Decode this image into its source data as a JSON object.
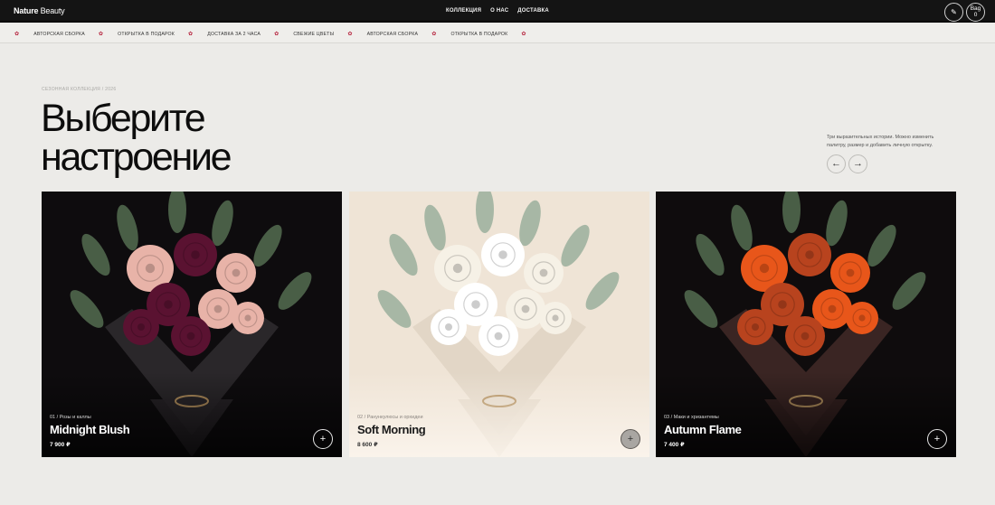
{
  "brand": {
    "bold": "Nature",
    "light": " Beauty"
  },
  "nav": [
    {
      "label": "КОЛЛЕКЦИЯ"
    },
    {
      "label": "О НАС"
    },
    {
      "label": "ДОСТАВКА"
    }
  ],
  "header": {
    "edit_icon": "edit-icon",
    "bag_label": "Bag",
    "bag_count": "0"
  },
  "ticker": [
    "АВТОРСКАЯ СБОРКА",
    "ОТКРЫТКА В ПОДАРОК",
    "ДОСТАВКА ЗА 2 ЧАСА",
    "СВЕЖИЕ ЦВЕТЫ",
    "АВТОРСКАЯ СБОРКА",
    "ОТКРЫТКА В ПОДАРОК"
  ],
  "hero": {
    "eyebrow": "СЕЗОННАЯ КОЛЛЕКЦИЯ / 2026",
    "headline_line1": "Выберите",
    "headline_line2": "настроение",
    "description": "Три выразительных истории. Можно изменить палитру, размер и добавить личную открытку.",
    "prev_arrow": "←",
    "next_arrow": "→"
  },
  "products": [
    {
      "meta": "01 / Розы и каллы",
      "name": "Midnight Blush",
      "price": "7 900 ₽",
      "theme": "dark",
      "background": "#0e0c0e",
      "wrap": "#2a272a",
      "flowers": [
        "#e8b3a8",
        "#5a1231"
      ]
    },
    {
      "meta": "02 / Ранункулюсы и орхидеи",
      "name": "Soft Morning",
      "price": "8 600 ₽",
      "theme": "light",
      "background": "#efe4d6",
      "wrap": "#e2d6c6",
      "flowers": [
        "#f6f1e6",
        "#ffffff"
      ]
    },
    {
      "meta": "03 / Маки и хризантемы",
      "name": "Autumn Flame",
      "price": "7 400 ₽",
      "theme": "dark",
      "background": "#0f0c0d",
      "wrap": "#3a2523",
      "flowers": [
        "#e8561a",
        "#b8431e"
      ]
    }
  ],
  "colors": {
    "accent": "#b5203b",
    "topbar": "#141414",
    "page_bg": "#ecebe8"
  }
}
